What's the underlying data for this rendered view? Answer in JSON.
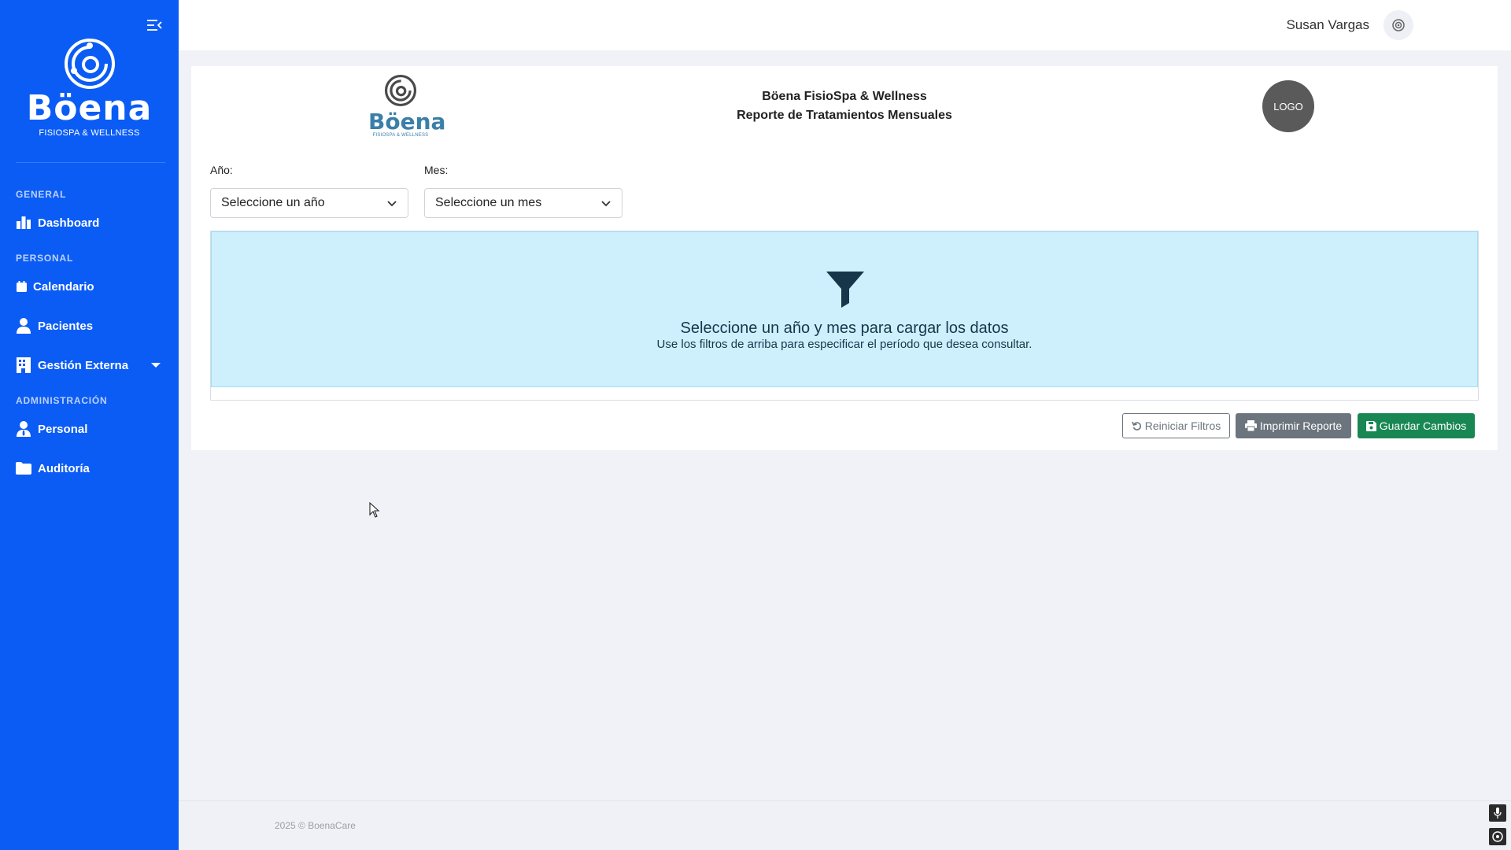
{
  "brand": {
    "name": "Böena",
    "subtitle": "FISIOSPA & WELLNESS"
  },
  "sidebar": {
    "sections": [
      {
        "label": "GENERAL"
      },
      {
        "label": "PERSONAL"
      },
      {
        "label": "ADMINISTRACIÓN"
      }
    ],
    "items": [
      {
        "label": "Dashboard",
        "icon": "bar-chart-icon"
      },
      {
        "label": "Calendario",
        "icon": "calendar-icon"
      },
      {
        "label": "Pacientes",
        "icon": "user-icon"
      },
      {
        "label": "Gestión Externa",
        "icon": "building-icon"
      },
      {
        "label": "Personal",
        "icon": "user-tie-icon"
      },
      {
        "label": "Auditoría",
        "icon": "folder-icon"
      }
    ]
  },
  "topbar": {
    "user_name": "Susan Vargas"
  },
  "report": {
    "logo_name": "Böena",
    "logo_sub": "FISIOSPA & WELLNESS",
    "title_line1": "Böena FisioSpa & Wellness",
    "title_line2": "Reporte de Tratamientos Mensuales",
    "logo_placeholder": "LOGO"
  },
  "filters": {
    "year_label": "Año:",
    "year_value": "Seleccione un año",
    "month_label": "Mes:",
    "month_value": "Seleccione un mes"
  },
  "empty_state": {
    "title": "Seleccione un año y mes para cargar los datos",
    "subtitle": "Use los filtros de arriba para especificar el período que desea consultar."
  },
  "actions": {
    "reset_label": "Reiniciar Filtros",
    "print_label": "Imprimir Reporte",
    "save_label": "Guardar Cambios"
  },
  "footer": {
    "text": "2025 © BoenaCare"
  },
  "colors": {
    "sidebar": "#0b5cf5",
    "info_box": "#cdf0fc",
    "save_button": "#198754",
    "print_button": "#6c757d"
  }
}
